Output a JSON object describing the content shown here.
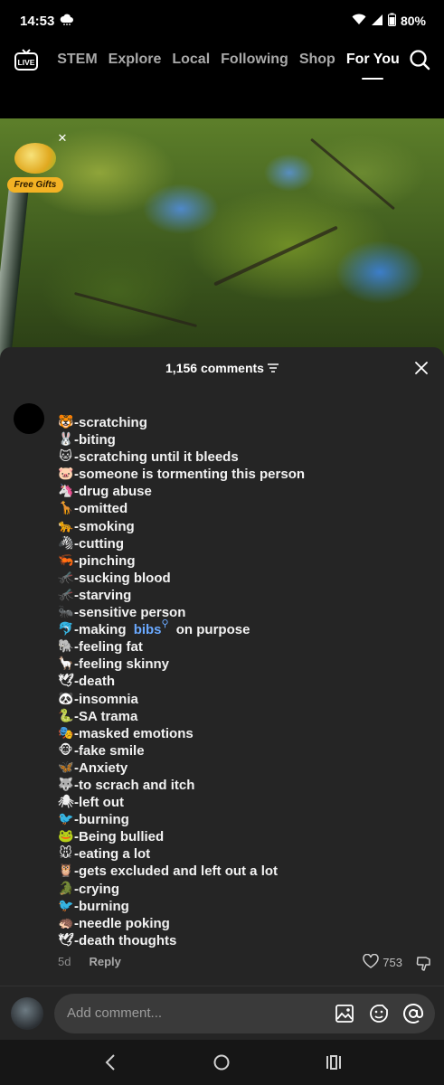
{
  "status_bar": {
    "time": "14:53",
    "battery": "80%"
  },
  "nav": {
    "tabs": [
      "STEM",
      "Explore",
      "Local",
      "Following",
      "Shop",
      "For You"
    ],
    "active_tab": "For You"
  },
  "gift_badge": {
    "label": "Free Gifts"
  },
  "comments_sheet": {
    "title": "1,156 comments",
    "lines": [
      {
        "emoji": "🐯",
        "text": "-scratching"
      },
      {
        "emoji": "🐰",
        "text": "-biting"
      },
      {
        "emoji": "🐱",
        "text": "-scratching until it bleeds"
      },
      {
        "emoji": "🐷",
        "text": "-someone is tormenting this person"
      },
      {
        "emoji": "🦄",
        "text": "-drug abuse"
      },
      {
        "emoji": "🦒",
        "text": "-omitted"
      },
      {
        "emoji": "🐆",
        "text": "-smoking"
      },
      {
        "emoji": "🦓",
        "text": "-cutting"
      },
      {
        "emoji": "🦐",
        "text": "-pinching"
      },
      {
        "emoji": "🦟",
        "text": "-sucking blood"
      },
      {
        "emoji": "🦟",
        "text": "-starving"
      },
      {
        "emoji": "🐜",
        "text": "-sensitive person"
      },
      {
        "emoji": "🐬",
        "text": "-making ",
        "link": "bibs",
        "after": " on purpose"
      },
      {
        "emoji": "🐘",
        "text": "-feeling fat"
      },
      {
        "emoji": "🦙",
        "text": "-feeling skinny"
      },
      {
        "emoji": "🕊",
        "text": "-death"
      },
      {
        "emoji": "🐼",
        "text": "-insomnia"
      },
      {
        "emoji": "🐍",
        "text": "-SA trama"
      },
      {
        "emoji": "🎭",
        "text": "-masked emotions"
      },
      {
        "emoji": "🐵",
        "text": "-fake smile"
      },
      {
        "emoji": "🦋",
        "text": "-Anxiety"
      },
      {
        "emoji": "🐺",
        "text": "-to scrach and itch"
      },
      {
        "emoji": "🕷",
        "text": "-left out"
      },
      {
        "emoji": "🐦",
        "text": "-burning"
      },
      {
        "emoji": "🐸",
        "text": "-Being bullied"
      },
      {
        "emoji": "🐭",
        "text": "-eating a lot"
      },
      {
        "emoji": "🦉",
        "text": "-gets excluded and left out a lot"
      },
      {
        "emoji": "🐊",
        "text": "-crying"
      },
      {
        "emoji": "🐦",
        "text": "-burning"
      },
      {
        "emoji": "🦔",
        "text": "-needle poking"
      },
      {
        "emoji": "🕊",
        "text": "-death thoughts"
      }
    ],
    "meta": {
      "time": "5d",
      "reply": "Reply",
      "likes": "753"
    }
  },
  "compose": {
    "placeholder": "Add comment..."
  },
  "icons": {
    "live": "live-tv-icon",
    "search": "search-icon",
    "close": "close-icon",
    "filter": "sort-lines-icon",
    "heart": "heart-outline-icon",
    "dislike": "thumbs-down-icon",
    "image": "image-icon",
    "sticker": "sticker-icon",
    "mention": "at-icon"
  },
  "colors": {
    "accent_link": "#6aa9ff",
    "sheet_bg": "#252525",
    "gift_badge": "#f3b224"
  }
}
